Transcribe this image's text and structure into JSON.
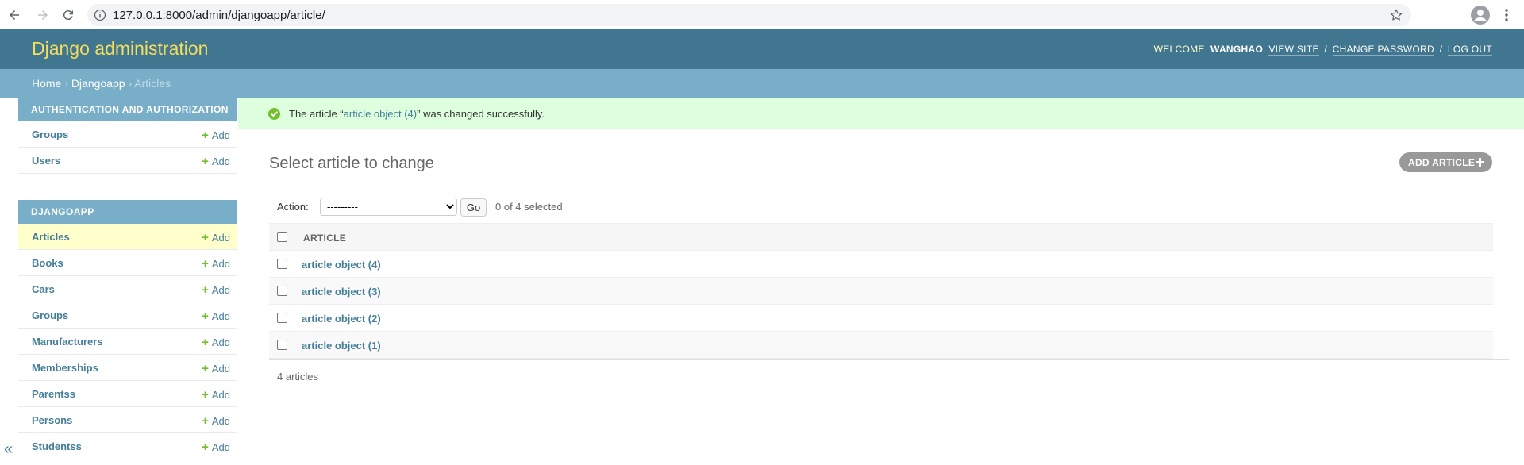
{
  "browser": {
    "url": "127.0.0.1:8000/admin/djangoapp/article/"
  },
  "header": {
    "site_name": "Django administration",
    "welcome": "Welcome, ",
    "username": "wanghao",
    "view_site": "View site",
    "change_password": "Change password",
    "log_out": "Log out",
    "separator": "/"
  },
  "breadcrumbs": {
    "home": "Home",
    "app": "Djangoapp",
    "current": "Articles",
    "separator": "›"
  },
  "sidebar": {
    "add_label": "Add",
    "modules": [
      {
        "caption": "Authentication and Authorization",
        "models": [
          "Groups",
          "Users"
        ]
      },
      {
        "caption": "Djangoapp",
        "models": [
          "Articles",
          "Books",
          "Cars",
          "Groups",
          "Manufacturers",
          "Memberships",
          "Parentss",
          "Persons",
          "Studentss"
        ]
      }
    ],
    "collapse_glyph": "«"
  },
  "message": {
    "prefix": "The article “",
    "link": "article object (4)",
    "suffix": "” was changed successfully."
  },
  "content": {
    "title": "Select article to change",
    "add_button": "Add article",
    "action_label": "Action:",
    "action_selected": "---------",
    "go_label": "Go",
    "counter": "0 of 4 selected",
    "column_header": "Article",
    "rows": [
      "article object (4)",
      "article object (3)",
      "article object (2)",
      "article object (1)"
    ],
    "result_count": "4 articles"
  },
  "colors": {
    "header_bg": "#417690",
    "breadcrumb_bg": "#79aec8",
    "brand_yellow": "#f5dd5d",
    "link_blue": "#447e9b",
    "success_bg": "#ddffdd",
    "add_green": "#70bf2b"
  },
  "icons": [
    "back-arrow-icon",
    "forward-arrow-icon",
    "reload-icon",
    "info-icon",
    "star-icon",
    "profile-icon",
    "kebab-menu-icon",
    "success-check-icon",
    "plus-icon"
  ]
}
